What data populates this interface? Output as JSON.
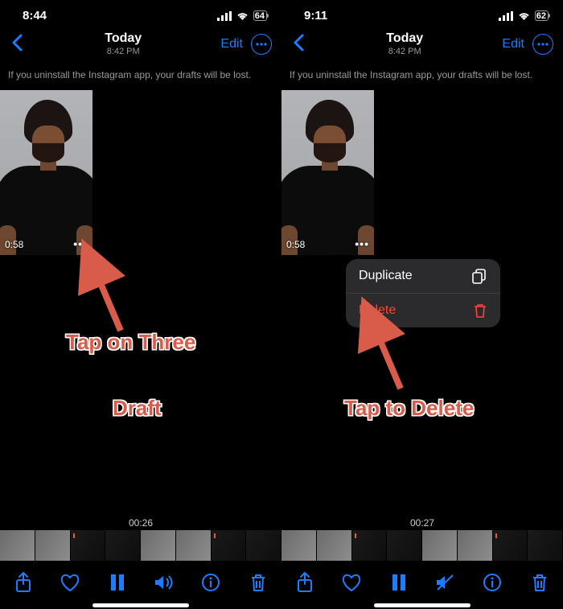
{
  "left": {
    "status": {
      "time": "8:44",
      "battery": "64"
    },
    "header": {
      "title": "Today",
      "subtitle": "8:42 PM",
      "edit": "Edit"
    },
    "warning": "If you uninstall the Instagram app, your drafts will be lost.",
    "draft": {
      "duration": "0:58"
    },
    "playhead": "00:26",
    "annotation1": "Tap on Three",
    "annotation2": "Draft"
  },
  "right": {
    "status": {
      "time": "9:11",
      "battery": "62"
    },
    "header": {
      "title": "Today",
      "subtitle": "8:42 PM",
      "edit": "Edit"
    },
    "warning": "If you uninstall the Instagram app, your drafts will be lost.",
    "draft": {
      "duration": "0:58"
    },
    "menu": {
      "duplicate": "Duplicate",
      "delete": "Delete"
    },
    "playhead": "00:27",
    "annotation": "Tap to Delete"
  },
  "icons": {
    "share": "share-icon",
    "heart": "heart-icon",
    "pause": "pause-icon",
    "volume": "volume-icon",
    "mute": "mute-icon",
    "info": "info-icon",
    "trash": "trash-icon",
    "copy": "copy-icon",
    "back": "chevron-left-icon",
    "more": "more-circle-icon"
  }
}
